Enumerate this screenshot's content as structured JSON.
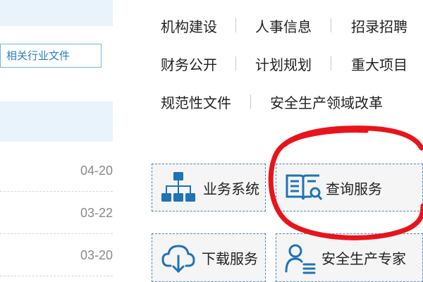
{
  "left_panel": {
    "tag_button_label": "相关行业文件",
    "dates": [
      "04-20",
      "03-22",
      "03-20"
    ]
  },
  "quick_links": {
    "row1": [
      "机构建设",
      "人事信息",
      "招录招聘"
    ],
    "row2": [
      "财务公开",
      "计划规划",
      "重大项目"
    ],
    "row3": [
      "规范性文件",
      "安全生产领域改革"
    ]
  },
  "services": {
    "business_system": "业务系统",
    "query_service": "查询服务",
    "download_service": "下载服务",
    "safety_expert": "安全生产专家"
  },
  "colors": {
    "icon_blue": "#1f73b7",
    "annotation_red": "#e8141c",
    "band_blue": "#e9f3fb"
  }
}
